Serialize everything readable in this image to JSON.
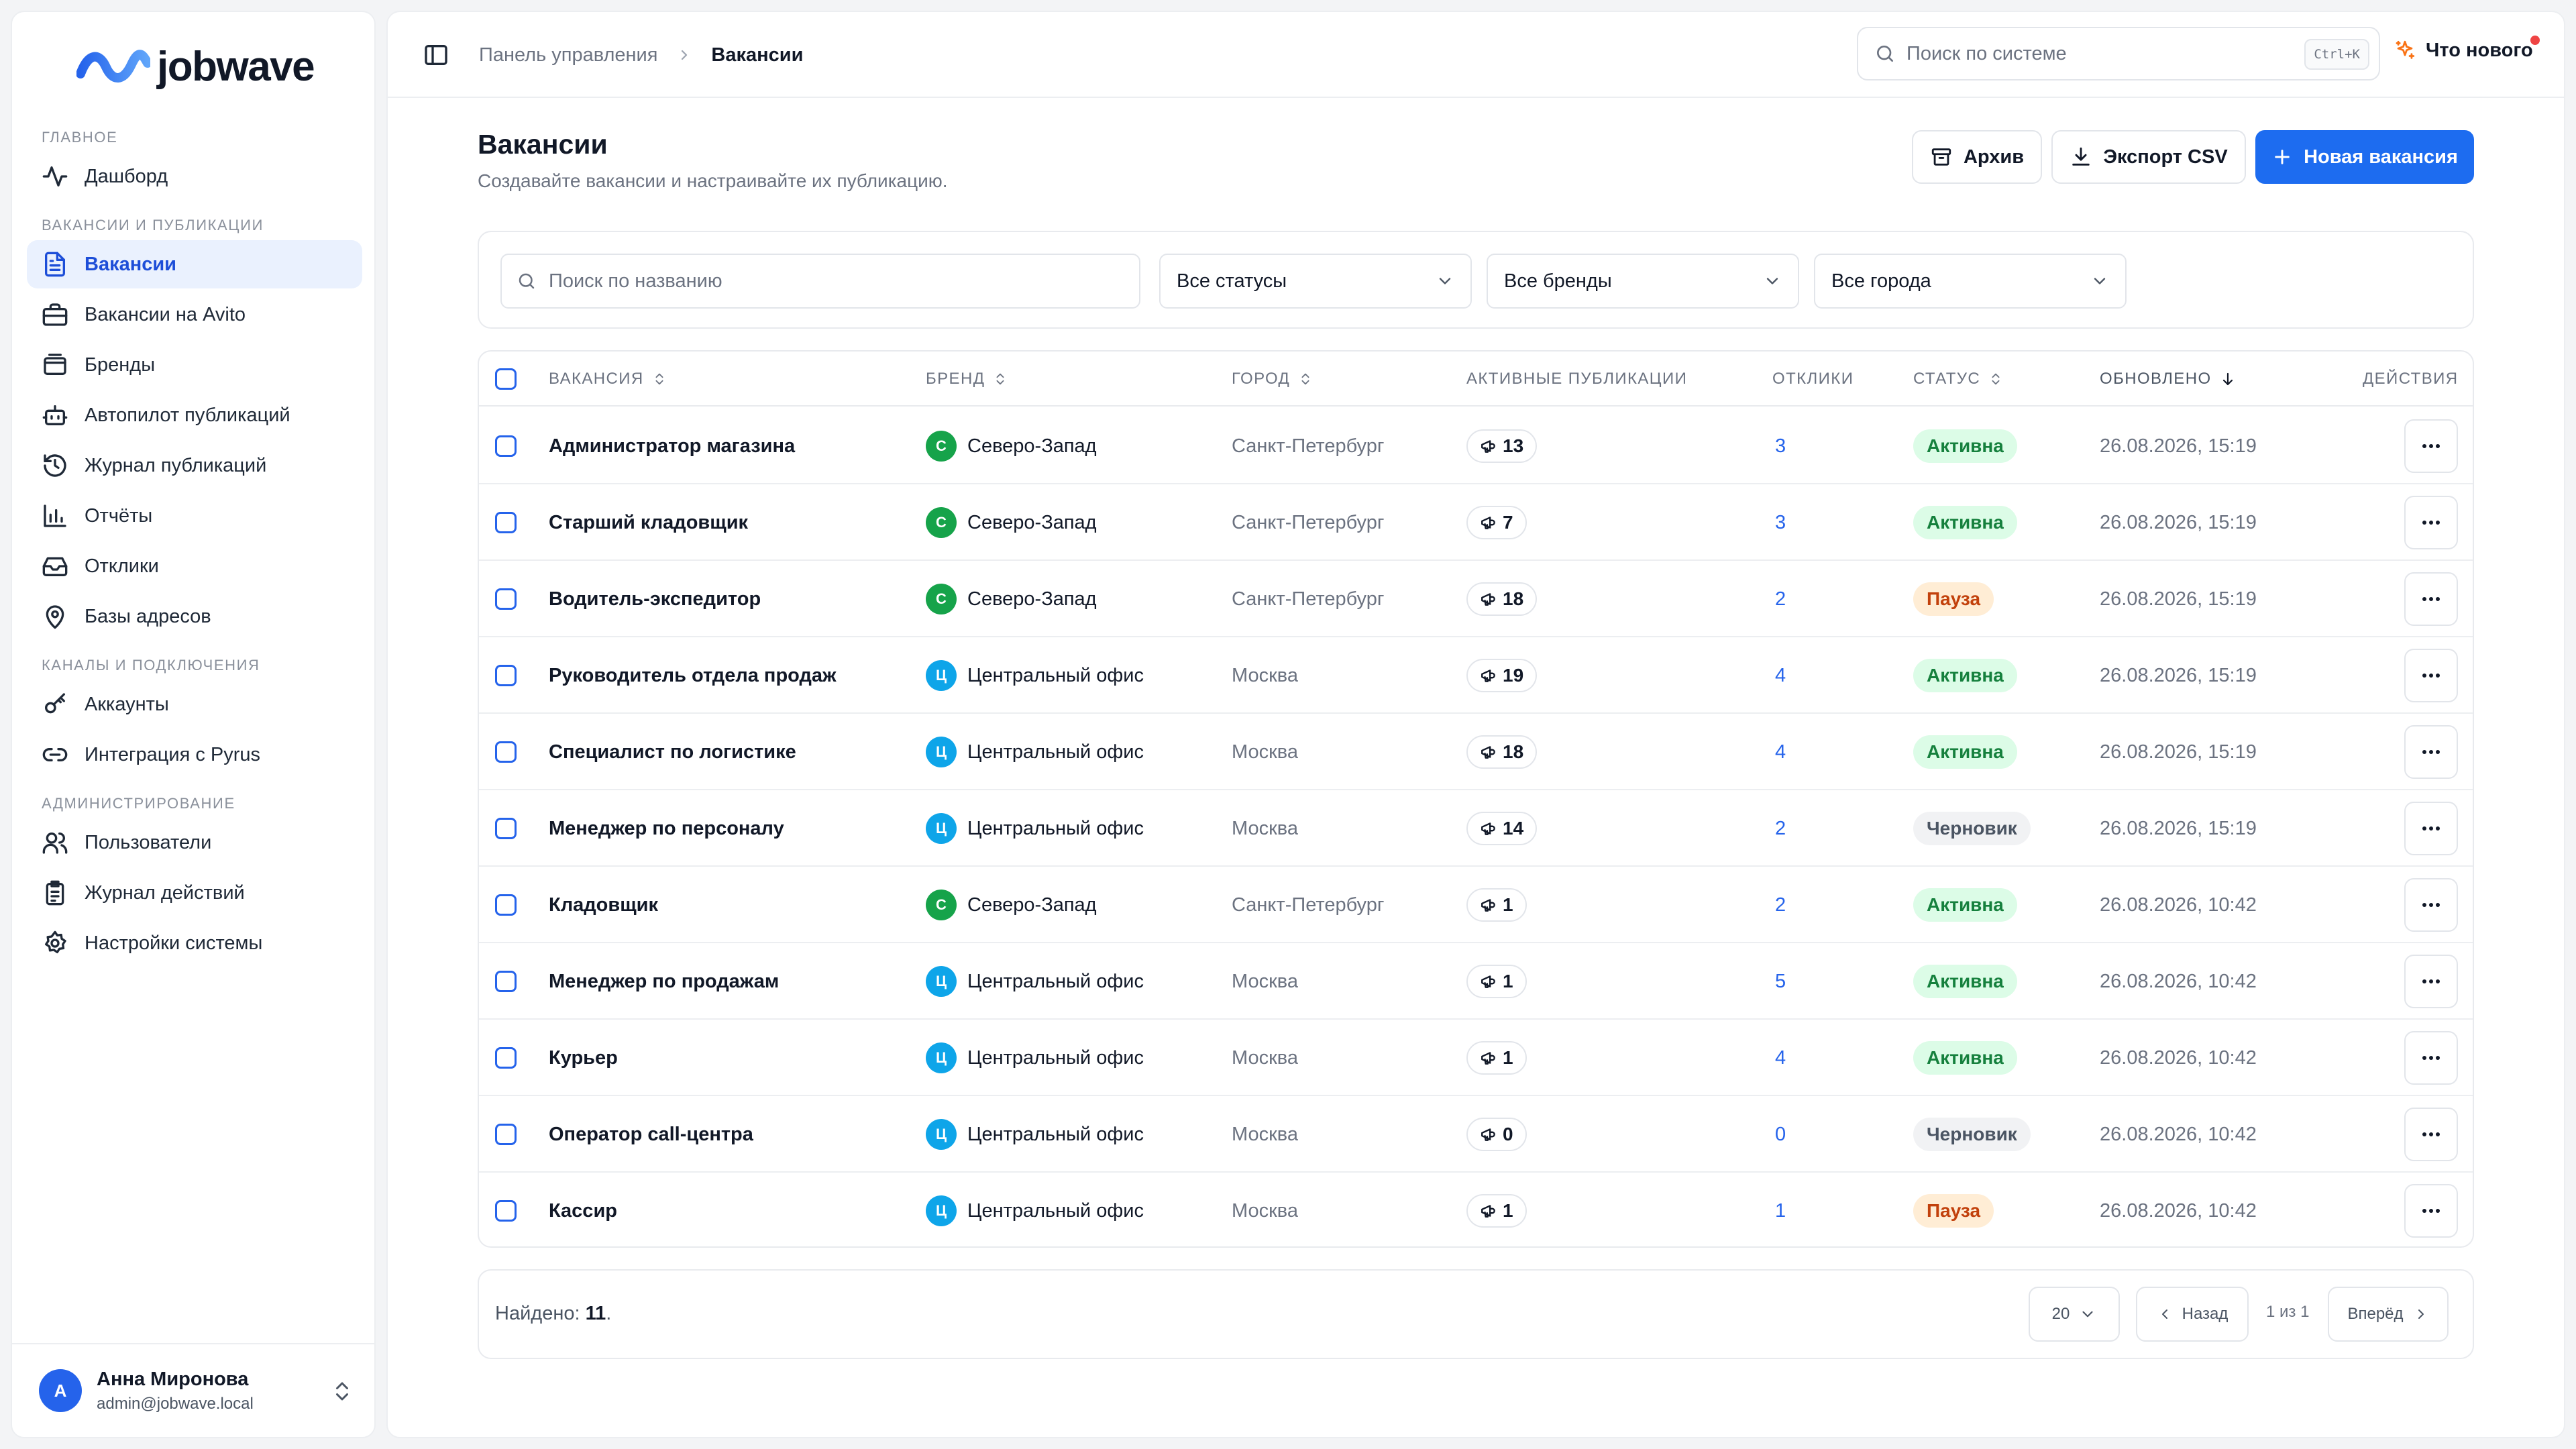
{
  "app": {
    "name": "jobwave"
  },
  "sidebar": {
    "sections": [
      {
        "title": "ГЛАВНОЕ",
        "items": [
          {
            "label": "Дашборд",
            "icon": "activity-icon"
          }
        ]
      },
      {
        "title": "ВАКАНСИИ И ПУБЛИКАЦИИ",
        "items": [
          {
            "label": "Вакансии",
            "icon": "document-icon",
            "active": true
          },
          {
            "label": "Вакансии на Avito",
            "icon": "briefcase-icon"
          },
          {
            "label": "Бренды",
            "icon": "wallet-icon"
          },
          {
            "label": "Автопилот публикаций",
            "icon": "bot-icon"
          },
          {
            "label": "Журнал публикаций",
            "icon": "history-icon"
          },
          {
            "label": "Отчёты",
            "icon": "bar-chart-icon"
          },
          {
            "label": "Отклики",
            "icon": "inbox-icon"
          },
          {
            "label": "Базы адресов",
            "icon": "map-pin-icon"
          }
        ]
      },
      {
        "title": "КАНАЛЫ И ПОДКЛЮЧЕНИЯ",
        "items": [
          {
            "label": "Аккаунты",
            "icon": "key-icon"
          },
          {
            "label": "Интеграция с Pyrus",
            "icon": "link-icon"
          }
        ]
      },
      {
        "title": "АДМИНИСТРИРОВАНИЕ",
        "items": [
          {
            "label": "Пользователи",
            "icon": "users-icon"
          },
          {
            "label": "Журнал действий",
            "icon": "clipboard-icon"
          },
          {
            "label": "Настройки системы",
            "icon": "settings-icon"
          }
        ]
      }
    ],
    "user": {
      "initial": "А",
      "name": "Анна Миронова",
      "email": "admin@jobwave.local"
    }
  },
  "topbar": {
    "breadcrumbs": [
      "Панель управления",
      "Вакансии"
    ],
    "search_placeholder": "Поиск по системе",
    "shortcut": "Ctrl+K",
    "whats_new": "Что нового"
  },
  "page": {
    "title": "Вакансии",
    "subtitle": "Создавайте вакансии и настраивайте их публикацию.",
    "buttons": {
      "archive": "Архив",
      "export": "Экспорт CSV",
      "new": "Новая вакансия"
    }
  },
  "filters": {
    "search_placeholder": "Поиск по названию",
    "status": "Все статусы",
    "brand": "Все бренды",
    "city": "Все города"
  },
  "table": {
    "columns": {
      "vacancy": "ВАКАНСИЯ",
      "brand": "БРЕНД",
      "city": "ГОРОД",
      "publications": "АКТИВНЫЕ ПУБЛИКАЦИИ",
      "responses": "ОТКЛИКИ",
      "status": "СТАТУС",
      "updated": "ОБНОВЛЕНО",
      "actions": "ДЕЙСТВИЯ"
    },
    "rows": [
      {
        "name": "Администратор магазина",
        "brand": "Северо-Запад",
        "brand_letter": "С",
        "city": "Санкт-Петербург",
        "pubs": "13",
        "responses": "3",
        "status": "Активна",
        "updated": "26.08.2026, 15:19"
      },
      {
        "name": "Старший кладовщик",
        "brand": "Северо-Запад",
        "brand_letter": "С",
        "city": "Санкт-Петербург",
        "pubs": "7",
        "responses": "3",
        "status": "Активна",
        "updated": "26.08.2026, 15:19"
      },
      {
        "name": "Водитель-экспедитор",
        "brand": "Северо-Запад",
        "brand_letter": "С",
        "city": "Санкт-Петербург",
        "pubs": "18",
        "responses": "2",
        "status": "Пауза",
        "updated": "26.08.2026, 15:19"
      },
      {
        "name": "Руководитель отдела продаж",
        "brand": "Центральный офис",
        "brand_letter": "Ц",
        "city": "Москва",
        "pubs": "19",
        "responses": "4",
        "status": "Активна",
        "updated": "26.08.2026, 15:19"
      },
      {
        "name": "Специалист по логистике",
        "brand": "Центральный офис",
        "brand_letter": "Ц",
        "city": "Москва",
        "pubs": "18",
        "responses": "4",
        "status": "Активна",
        "updated": "26.08.2026, 15:19"
      },
      {
        "name": "Менеджер по персоналу",
        "brand": "Центральный офис",
        "brand_letter": "Ц",
        "city": "Москва",
        "pubs": "14",
        "responses": "2",
        "status": "Черновик",
        "updated": "26.08.2026, 15:19"
      },
      {
        "name": "Кладовщик",
        "brand": "Северо-Запад",
        "brand_letter": "С",
        "city": "Санкт-Петербург",
        "pubs": "1",
        "responses": "2",
        "status": "Активна",
        "updated": "26.08.2026, 10:42"
      },
      {
        "name": "Менеджер по продажам",
        "brand": "Центральный офис",
        "brand_letter": "Ц",
        "city": "Москва",
        "pubs": "1",
        "responses": "5",
        "status": "Активна",
        "updated": "26.08.2026, 10:42"
      },
      {
        "name": "Курьер",
        "brand": "Центральный офис",
        "brand_letter": "Ц",
        "city": "Москва",
        "pubs": "1",
        "responses": "4",
        "status": "Активна",
        "updated": "26.08.2026, 10:42"
      },
      {
        "name": "Оператор call-центра",
        "brand": "Центральный офис",
        "brand_letter": "Ц",
        "city": "Москва",
        "pubs": "0",
        "responses": "0",
        "status": "Черновик",
        "updated": "26.08.2026, 10:42"
      },
      {
        "name": "Кассир",
        "brand": "Центральный офис",
        "brand_letter": "Ц",
        "city": "Москва",
        "pubs": "1",
        "responses": "1",
        "status": "Пауза",
        "updated": "26.08.2026, 10:42"
      }
    ]
  },
  "footer": {
    "found_label": "Найдено: ",
    "found_count": "11",
    "page_size": "20",
    "prev": "Назад",
    "page_info": "1 из 1",
    "next": "Вперёд"
  },
  "colors": {
    "accent": "#1d6cf0",
    "brand_north_west": "#16a34a",
    "brand_central": "#0ea5e9",
    "status_active_bg": "#dcfce7",
    "status_active_fg": "#15803d",
    "status_pause_bg": "#ffedd5",
    "status_pause_fg": "#c2410c",
    "status_draft_bg": "#f1f2f4",
    "status_draft_fg": "#4b5563"
  }
}
